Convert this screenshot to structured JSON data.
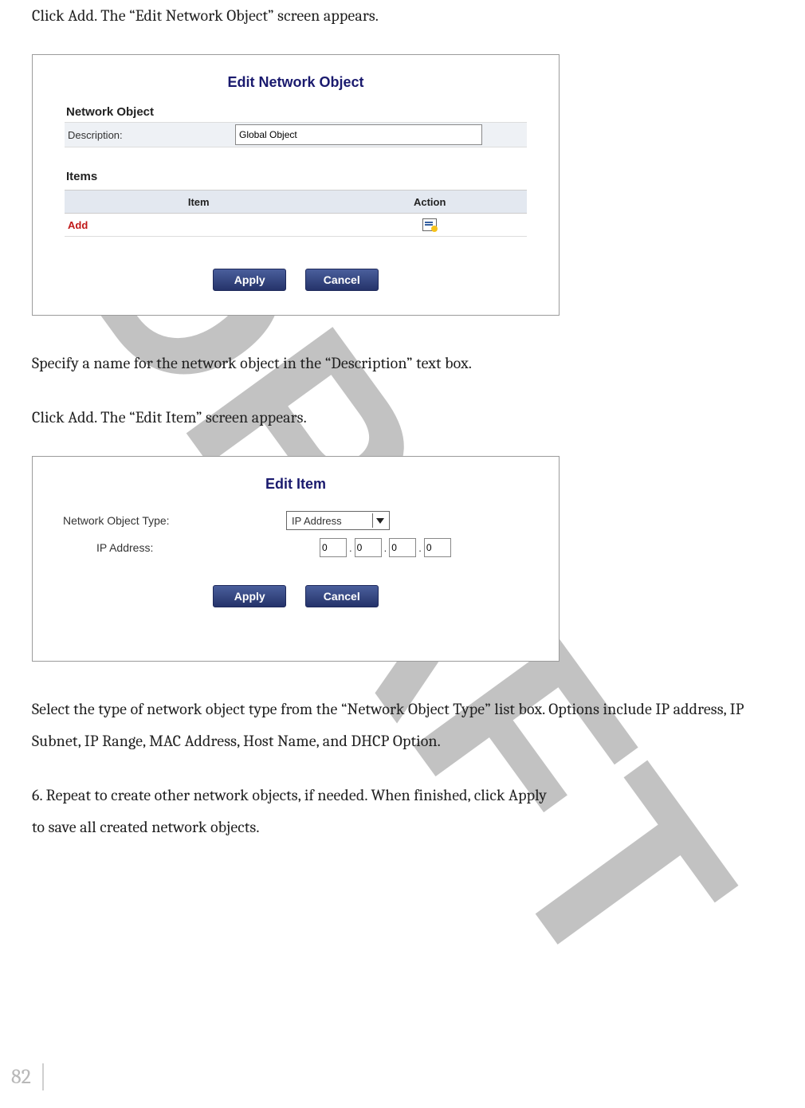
{
  "watermark": "DRAFT",
  "paragraphs": {
    "p1": "Click Add. The “Edit Network Object” screen appears.",
    "p2": "Specify a name for the network object in the “Description” text box.",
    "p3": "Click Add. The “Edit Item” screen appears.",
    "p4": "Select the type of network object type from the “Network Object Type” list box. Options include IP address, IP Subnet, IP Range, MAC Address, Host Name, and DHCP Option.",
    "p5a": "6.  Repeat to create other network objects, if needed. When finished, click Apply",
    "p5b": "to save all created network objects."
  },
  "panel_network_object": {
    "title": "Edit Network Object",
    "section1": "Network Object",
    "description_label": "Description:",
    "description_value": "Global Object",
    "section2": "Items",
    "col_item": "Item",
    "col_action": "Action",
    "add_label": "Add",
    "apply_button": "Apply",
    "cancel_button": "Cancel"
  },
  "panel_item": {
    "title": "Edit Item",
    "type_label": "Network Object Type:",
    "type_selected": "IP Address",
    "ip_label": "IP Address:",
    "ip_segments": [
      "0",
      "0",
      "0",
      "0"
    ],
    "apply_button": "Apply",
    "cancel_button": "Cancel"
  },
  "page_number": "82"
}
